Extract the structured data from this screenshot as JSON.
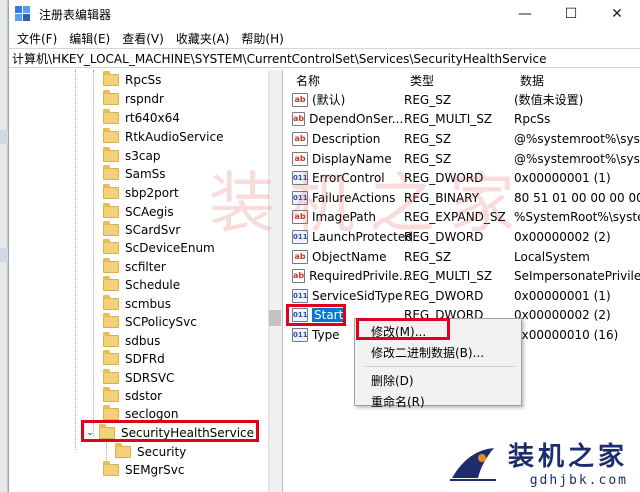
{
  "window": {
    "title": "注册表编辑器",
    "controls": [
      "—",
      "☐",
      "✕"
    ]
  },
  "menu": [
    "文件(F)",
    "编辑(E)",
    "查看(V)",
    "收藏夹(A)",
    "帮助(H)"
  ],
  "address": "计算机\\HKEY_LOCAL_MACHINE\\SYSTEM\\CurrentControlSet\\Services\\SecurityHealthService",
  "tree": {
    "items": [
      {
        "label": "RpcSs",
        "expander": ""
      },
      {
        "label": "rspndr",
        "expander": ""
      },
      {
        "label": "rt640x64",
        "expander": ""
      },
      {
        "label": "RtkAudioService",
        "expander": ""
      },
      {
        "label": "s3cap",
        "expander": ""
      },
      {
        "label": "SamSs",
        "expander": ""
      },
      {
        "label": "sbp2port",
        "expander": ""
      },
      {
        "label": "SCAegis",
        "expander": ""
      },
      {
        "label": "SCardSvr",
        "expander": ""
      },
      {
        "label": "ScDeviceEnum",
        "expander": ""
      },
      {
        "label": "scfilter",
        "expander": ""
      },
      {
        "label": "Schedule",
        "expander": ""
      },
      {
        "label": "scmbus",
        "expander": ""
      },
      {
        "label": "SCPolicySvc",
        "expander": ""
      },
      {
        "label": "sdbus",
        "expander": ""
      },
      {
        "label": "SDFRd",
        "expander": ""
      },
      {
        "label": "SDRSVC",
        "expander": ""
      },
      {
        "label": "sdstor",
        "expander": ""
      },
      {
        "label": "seclogon",
        "expander": ""
      },
      {
        "label": "SecurityHealthService",
        "expander": "⌄"
      },
      {
        "label": "Security",
        "expander": ""
      },
      {
        "label": "SEMgrSvc",
        "expander": ""
      }
    ]
  },
  "list": {
    "headers": {
      "name": "名称",
      "type": "类型",
      "data": "数据"
    },
    "rows": [
      {
        "icon": "ab",
        "name": "(默认)",
        "type": "REG_SZ",
        "data": "(数值未设置)"
      },
      {
        "icon": "ab",
        "name": "DependOnSer...",
        "type": "REG_MULTI_SZ",
        "data": "RpcSs"
      },
      {
        "icon": "ab",
        "name": "Description",
        "type": "REG_SZ",
        "data": "@%systemroot%\\syst"
      },
      {
        "icon": "ab",
        "name": "DisplayName",
        "type": "REG_SZ",
        "data": "@%systemroot%\\syst"
      },
      {
        "icon": "010",
        "name": "ErrorControl",
        "type": "REG_DWORD",
        "data": "0x00000001 (1)"
      },
      {
        "icon": "010",
        "name": "FailureActions",
        "type": "REG_BINARY",
        "data": "80 51 01 00 00 00 00"
      },
      {
        "icon": "ab",
        "name": "ImagePath",
        "type": "REG_EXPAND_SZ",
        "data": "%SystemRoot%\\syste"
      },
      {
        "icon": "010",
        "name": "LaunchProtected",
        "type": "REG_DWORD",
        "data": "0x00000002 (2)"
      },
      {
        "icon": "ab",
        "name": "ObjectName",
        "type": "REG_SZ",
        "data": "LocalSystem"
      },
      {
        "icon": "ab",
        "name": "RequiredPrivile...",
        "type": "REG_MULTI_SZ",
        "data": "SeImpersonatePrivile"
      },
      {
        "icon": "010",
        "name": "ServiceSidType",
        "type": "REG_DWORD",
        "data": "0x00000001 (1)"
      },
      {
        "icon": "010",
        "name": "Start",
        "type": "REG_DWORD",
        "data": "0x00000002 (2)"
      },
      {
        "icon": "010",
        "name": "Type",
        "type": "REG_DWORD",
        "data": "0x00000010 (16)"
      }
    ]
  },
  "context_menu": {
    "items": [
      "修改(M)...",
      "修改二进制数据(B)...",
      "删除(D)",
      "重命名(R)"
    ]
  },
  "watermark": {
    "text": "装机之家",
    "brand_cn": "装机之家",
    "brand_url": "gdhjbk.com"
  },
  "colors": {
    "selection": "#0078d7",
    "highlight_box": "#e0001b",
    "watermark": "#d63c3c"
  }
}
